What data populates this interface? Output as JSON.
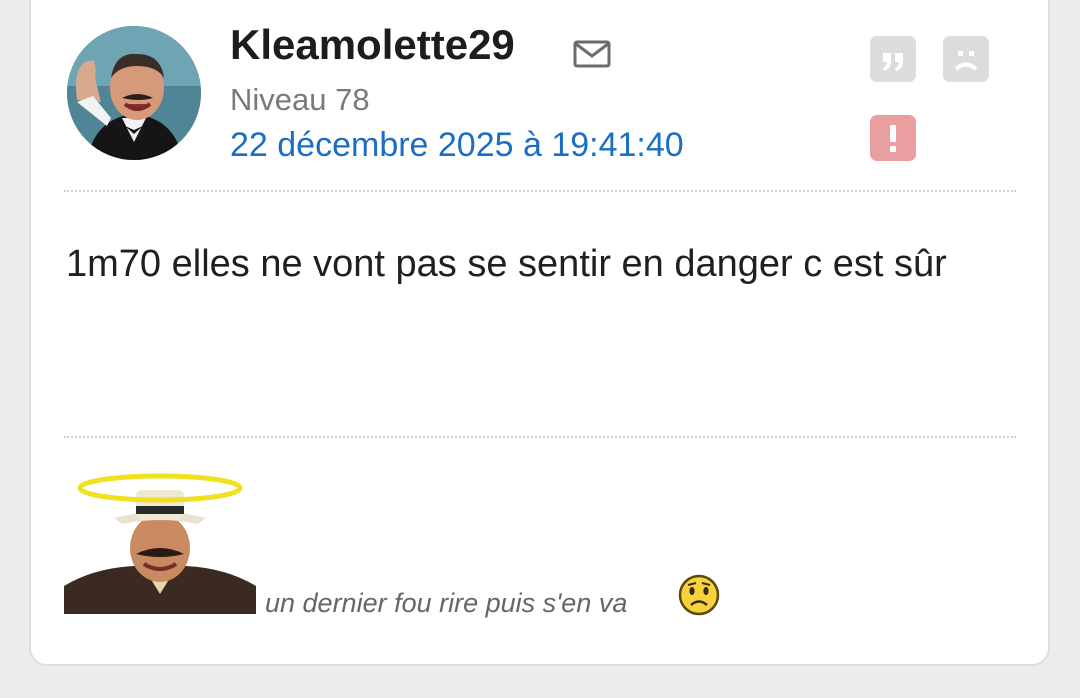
{
  "post": {
    "author": "Kleamolette29",
    "level": "Niveau 78",
    "date": "22 décembre 2025 à 19:41:40",
    "message": "1m70 elles ne vont pas se sentir en danger c est sûr",
    "signature_text": "un dernier fou rire puis s'en va"
  },
  "icons": {
    "mail": "mail-icon",
    "quote": "quote-icon",
    "sad": "sad-face-icon",
    "alert": "alert-icon",
    "smiley": "worried-smiley-icon"
  },
  "colors": {
    "author": "#1d1d1d",
    "date_link": "#1b6ec2",
    "level": "#7a7a7a",
    "alert_button": "#e99e9f",
    "action_button": "#dcdcdc"
  }
}
